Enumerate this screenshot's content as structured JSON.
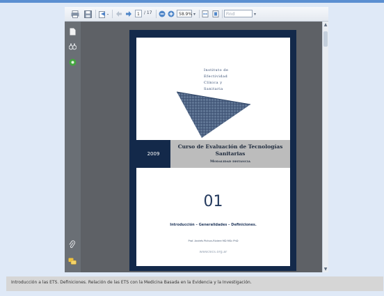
{
  "toolbar": {
    "page_current": "1",
    "page_total": "/ 17",
    "zoom": "58.9%",
    "find_placeholder": "Find"
  },
  "rail": {
    "icons": [
      "pages-icon",
      "bookmarks-icon",
      "attachments-icon",
      "paperclip-icon",
      "comments-icon"
    ]
  },
  "document": {
    "institute_lines": [
      "Instituto de",
      "Efectividad",
      "Clínica y",
      "Sanitaria"
    ],
    "year": "2009",
    "title_line1": "Curso de Evaluación de Tecnologías",
    "title_line2": "Sanitarias",
    "subtitle": "Modalidad distancia",
    "number": "01",
    "intro": "Introducción – Generalidades – Definiciones.",
    "author": "Prof. Andrés Pichon-Riviere MD MSc PhD",
    "website": "www.iecs.org.ar"
  },
  "caption": {
    "text": "Introducción a las ETS. Definiciones. Relación de las ETS con la Medicina Basada en la Evidencia y la Investigación."
  },
  "colors": {
    "background": "#dfe9f7",
    "page_border": "#13294a",
    "band": "#bcbcbc",
    "accent_green": "#43a63f"
  }
}
